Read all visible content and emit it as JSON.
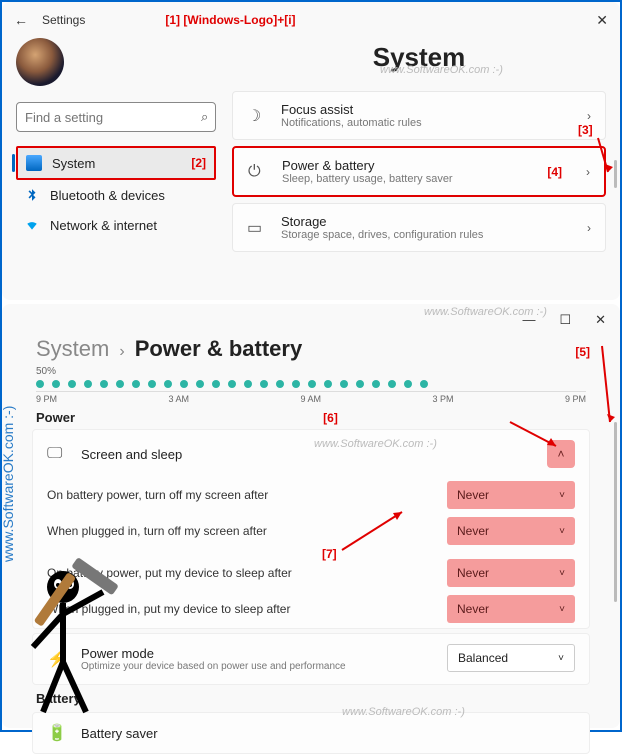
{
  "annotation": {
    "a1": "[1] [Windows-Logo]+[i]",
    "a2": "[2]",
    "a3": "[3]",
    "a4": "[4]",
    "a5": "[5]",
    "a6": "[6]",
    "a7": "[7]"
  },
  "watermark": "www.SoftwareOK.com :-)",
  "window1": {
    "app_title": "Settings",
    "page_title": "System",
    "search_placeholder": "Find a setting",
    "nav": [
      {
        "label": "System",
        "icon": "system"
      },
      {
        "label": "Bluetooth & devices",
        "icon": "bluetooth"
      },
      {
        "label": "Network & internet",
        "icon": "network"
      }
    ],
    "cards": [
      {
        "icon": "moon",
        "title": "Focus assist",
        "sub": "Notifications, automatic rules"
      },
      {
        "icon": "power",
        "title": "Power & battery",
        "sub": "Sleep, battery usage, battery saver"
      },
      {
        "icon": "storage",
        "title": "Storage",
        "sub": "Storage space, drives, configuration rules"
      }
    ]
  },
  "window2": {
    "breadcrumb_a": "System",
    "breadcrumb_b": "Power & battery",
    "section_power": "Power",
    "section_battery": "Battery",
    "screen_sleep": {
      "title": "Screen and sleep",
      "rows": [
        {
          "label": "On battery power, turn off my screen after",
          "value": "Never"
        },
        {
          "label": "When plugged in, turn off my screen after",
          "value": "Never"
        },
        {
          "label": "On battery power, put my device to sleep after",
          "value": "Never"
        },
        {
          "label": "When plugged in, put my device to sleep after",
          "value": "Never"
        }
      ]
    },
    "power_mode": {
      "title": "Power mode",
      "sub": "Optimize your device based on power use and performance",
      "value": "Balanced"
    },
    "battery_saver": {
      "title": "Battery saver"
    }
  },
  "chart_data": {
    "type": "bar",
    "title": "",
    "ylabel": "",
    "xlabel": "",
    "ylim": [
      0,
      100
    ],
    "y_tick": "50%",
    "categories": [
      "9 PM",
      "3 AM",
      "9 AM",
      "3 PM",
      "9 PM"
    ],
    "values": [
      50,
      50,
      50,
      50,
      50,
      50,
      50,
      50,
      50,
      50,
      50,
      50,
      50,
      50,
      50,
      50,
      50,
      50,
      50,
      50,
      50,
      50,
      50,
      50,
      50
    ]
  }
}
